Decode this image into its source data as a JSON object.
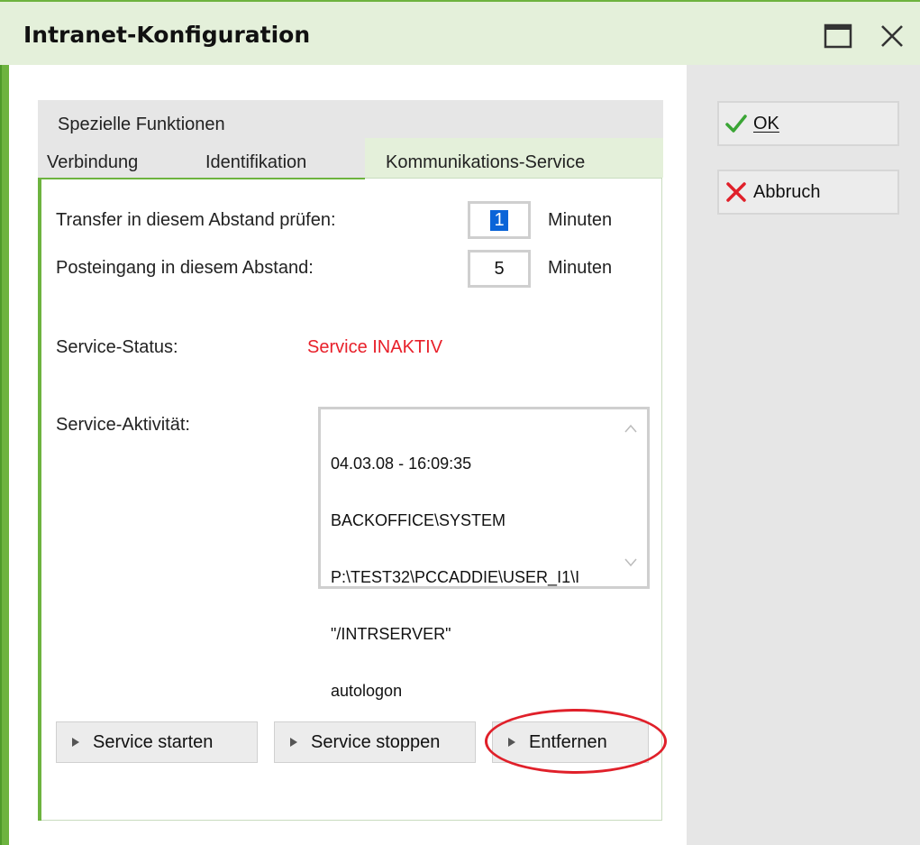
{
  "window": {
    "title": "Intranet-Konfiguration"
  },
  "side_buttons": {
    "ok_label": "OK",
    "cancel_label": "Abbruch"
  },
  "tabs": {
    "row_top": [
      "Spezielle Funktionen"
    ],
    "row_bottom": [
      "Verbindung",
      "Identifikation",
      "Kommunikations-Service"
    ],
    "active": "Kommunikations-Service"
  },
  "form": {
    "transfer_label": "Transfer in diesem Abstand prüfen:",
    "transfer_value": "1",
    "transfer_unit": "Minuten",
    "posteingang_label": "Posteingang in diesem Abstand:",
    "posteingang_value": "5",
    "posteingang_unit": "Minuten",
    "status_label": "Service-Status:",
    "status_value": "Service INAKTIV",
    "activity_label": "Service-Aktivität:",
    "activity_lines": [
      "04.03.08 - 16:09:35",
      "BACKOFFICE\\SYSTEM",
      "P:\\TEST32\\PCCADDIE\\USER_I1\\I",
      "\"/INTRSERVER\"",
      "autologon"
    ]
  },
  "actions": {
    "start_label": "Service starten",
    "stop_label": "Service stoppen",
    "remove_label": "Entfernen"
  },
  "colors": {
    "accent_green": "#6db33f",
    "status_red": "#e8202a",
    "highlight_red": "#e0202a"
  }
}
